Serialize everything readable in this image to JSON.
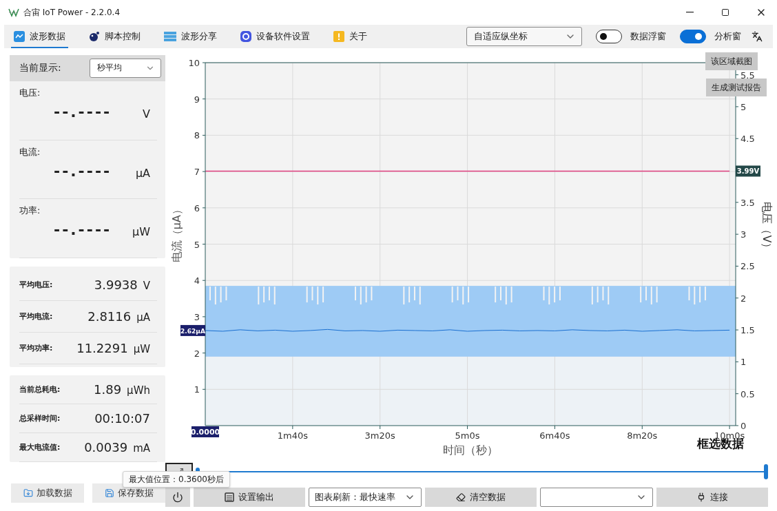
{
  "window": {
    "title": "合宙 IoT Power - 2.2.0.4"
  },
  "tabs": [
    {
      "label": "波形数据",
      "selected": true,
      "kind": "wave"
    },
    {
      "label": "脚本控制",
      "selected": false,
      "kind": "script"
    },
    {
      "label": "波形分享",
      "selected": false,
      "kind": "share"
    },
    {
      "label": "设备软件设置",
      "selected": false,
      "kind": "settings"
    },
    {
      "label": "关于",
      "selected": false,
      "kind": "about"
    }
  ],
  "scale_select": {
    "value": "自适应纵坐标"
  },
  "toggles": [
    {
      "label": "数据浮窗",
      "on": false
    },
    {
      "label": "分析窗",
      "on": true
    }
  ],
  "live_panel": {
    "label": "当前显示:",
    "mode": "秒平均",
    "readings": [
      {
        "label": "电压:",
        "value": "--.----",
        "unit": "V"
      },
      {
        "label": "电流:",
        "value": "--.----",
        "unit": "μA"
      },
      {
        "label": "功率:",
        "value": "--.----",
        "unit": "μW"
      }
    ]
  },
  "averages": [
    {
      "label": "平均电压:",
      "value": "3.9938",
      "unit": "V"
    },
    {
      "label": "平均电流:",
      "value": "2.8116",
      "unit": "μA"
    },
    {
      "label": "平均功率:",
      "value": "11.2291",
      "unit": "μW"
    }
  ],
  "totals": [
    {
      "label": "当前总耗电:",
      "value": "1.89",
      "unit": "μWh"
    },
    {
      "label": "总采样时间:",
      "value": "00:10:07"
    },
    {
      "label": "最大电流值:",
      "value": "0.0039",
      "unit": "mA"
    }
  ],
  "chart": {
    "buttons": [
      "该区域截图",
      "生成测试报告"
    ],
    "select_label": "框选数据",
    "badges": [
      {
        "text": "2.62μA",
        "kind": "current"
      },
      {
        "text": "3.99V",
        "kind": "voltage"
      },
      {
        "text": "0.0000",
        "kind": "time"
      }
    ],
    "chart_data": {
      "type": "line",
      "xlabel": "时间（秒）",
      "ylabel": "电流（μA）",
      "y2label": "电压（V）",
      "ylim": [
        0,
        10
      ],
      "y2lim": [
        0,
        5.69
      ],
      "grid": true,
      "categories": [
        null,
        null,
        null,
        null,
        null,
        "1m40s",
        null,
        null,
        null,
        null,
        "3m20s",
        null,
        null,
        null,
        null,
        "5m0s",
        null,
        null,
        null,
        null,
        "6m40s",
        null,
        null,
        null,
        null,
        "8m20s",
        null,
        null,
        null,
        null,
        "10m0s"
      ],
      "yticks": [
        1,
        2,
        3,
        4,
        5,
        6,
        7,
        8,
        9,
        10
      ],
      "y2ticks": [
        0,
        0.5,
        1,
        1.5,
        2,
        2.5,
        3,
        3.5,
        4.5,
        5,
        5.5
      ],
      "bands": [
        {
          "axis": "y",
          "from": 1.9,
          "to": 3.85,
          "color": "#9ecbf5"
        }
      ],
      "series": [
        {
          "color": "#1a6fd0",
          "values": [
            2.62,
            2.6,
            2.64,
            2.61,
            2.63,
            2.6,
            2.62,
            2.65,
            2.61,
            2.62,
            2.6,
            2.63,
            2.62,
            2.61,
            2.64,
            2.6,
            2.62,
            2.63,
            2.61,
            2.62,
            2.61,
            2.64,
            2.62,
            2.61,
            2.63,
            2.6,
            2.62,
            2.64,
            2.61,
            2.62,
            2.63
          ]
        },
        {
          "color": "#e0407f",
          "axis": "y2",
          "values": [
            3.99,
            3.99,
            3.99,
            3.99,
            3.99,
            3.99,
            3.99,
            3.99,
            3.99,
            3.99,
            3.99,
            3.99,
            3.99,
            3.99,
            3.99,
            3.99,
            3.99,
            3.99,
            3.99,
            3.99,
            3.99,
            3.99,
            3.99,
            3.99,
            3.99,
            3.99,
            3.99,
            3.99,
            3.99,
            3.99,
            3.99
          ]
        }
      ]
    }
  },
  "slider": {
    "level": 1
  },
  "tooltip": "最大值位置：0.3600秒后",
  "file_buttons": [
    {
      "label": "加载数据",
      "kind": "load"
    },
    {
      "label": "保存数据",
      "kind": "save"
    }
  ],
  "controls": [
    {
      "kind": "power"
    },
    {
      "kind": "output",
      "label": "设置输出"
    },
    {
      "kind": "select",
      "value": "图表刷新：最快速率"
    },
    {
      "kind": "clear",
      "label": "清空数据"
    },
    {
      "kind": "select"
    },
    {
      "kind": "connect",
      "label": "连接"
    }
  ]
}
